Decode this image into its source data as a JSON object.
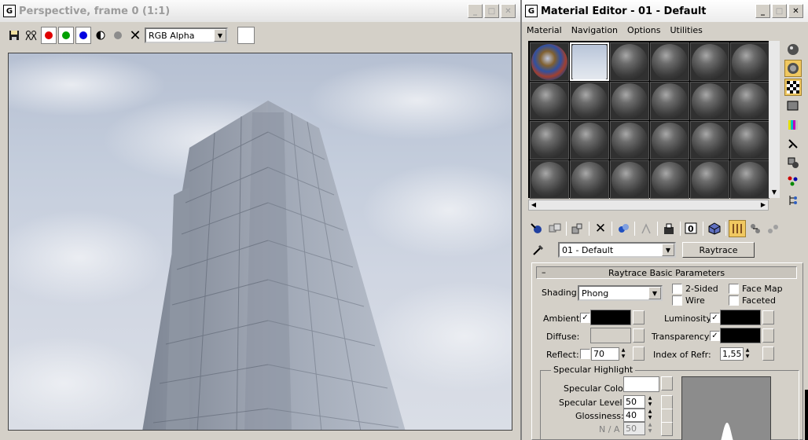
{
  "frame_window": {
    "title": "Perspective, frame 0 (1:1)",
    "channel_select": "RGB Alpha"
  },
  "material_editor": {
    "title": "Material Editor - 01 - Default",
    "menu": [
      "Material",
      "Navigation",
      "Options",
      "Utilities"
    ],
    "material_name": "01 - Default",
    "material_type_button": "Raytrace",
    "rollout_title": "Raytrace Basic Parameters",
    "shading": {
      "label": "Shading:",
      "value": "Phong"
    },
    "checkboxes": {
      "two_sided": "2-Sided",
      "wire": "Wire",
      "face_map": "Face Map",
      "faceted": "Faceted"
    },
    "params": {
      "ambient": "Ambient:",
      "diffuse": "Diffuse:",
      "reflect": "Reflect:",
      "reflect_value": "70",
      "luminosity": "Luminosity:",
      "transparency": "Transparency:",
      "index_of_refr": "Index of Refr:",
      "index_of_refr_value": "1,55"
    },
    "specular": {
      "group_title": "Specular Highlight",
      "color_label": "Specular Color",
      "level_label": "Specular Level:",
      "level_value": "50",
      "glossiness_label": "Glossiness:",
      "glossiness_value": "40",
      "na_label": "N / A",
      "na_value": "50"
    },
    "colors": {
      "ambient": "#000000",
      "diffuse": "#d4d0c8",
      "luminosity": "#000000",
      "transparency": "#000000",
      "specular": "#ffffff"
    }
  }
}
